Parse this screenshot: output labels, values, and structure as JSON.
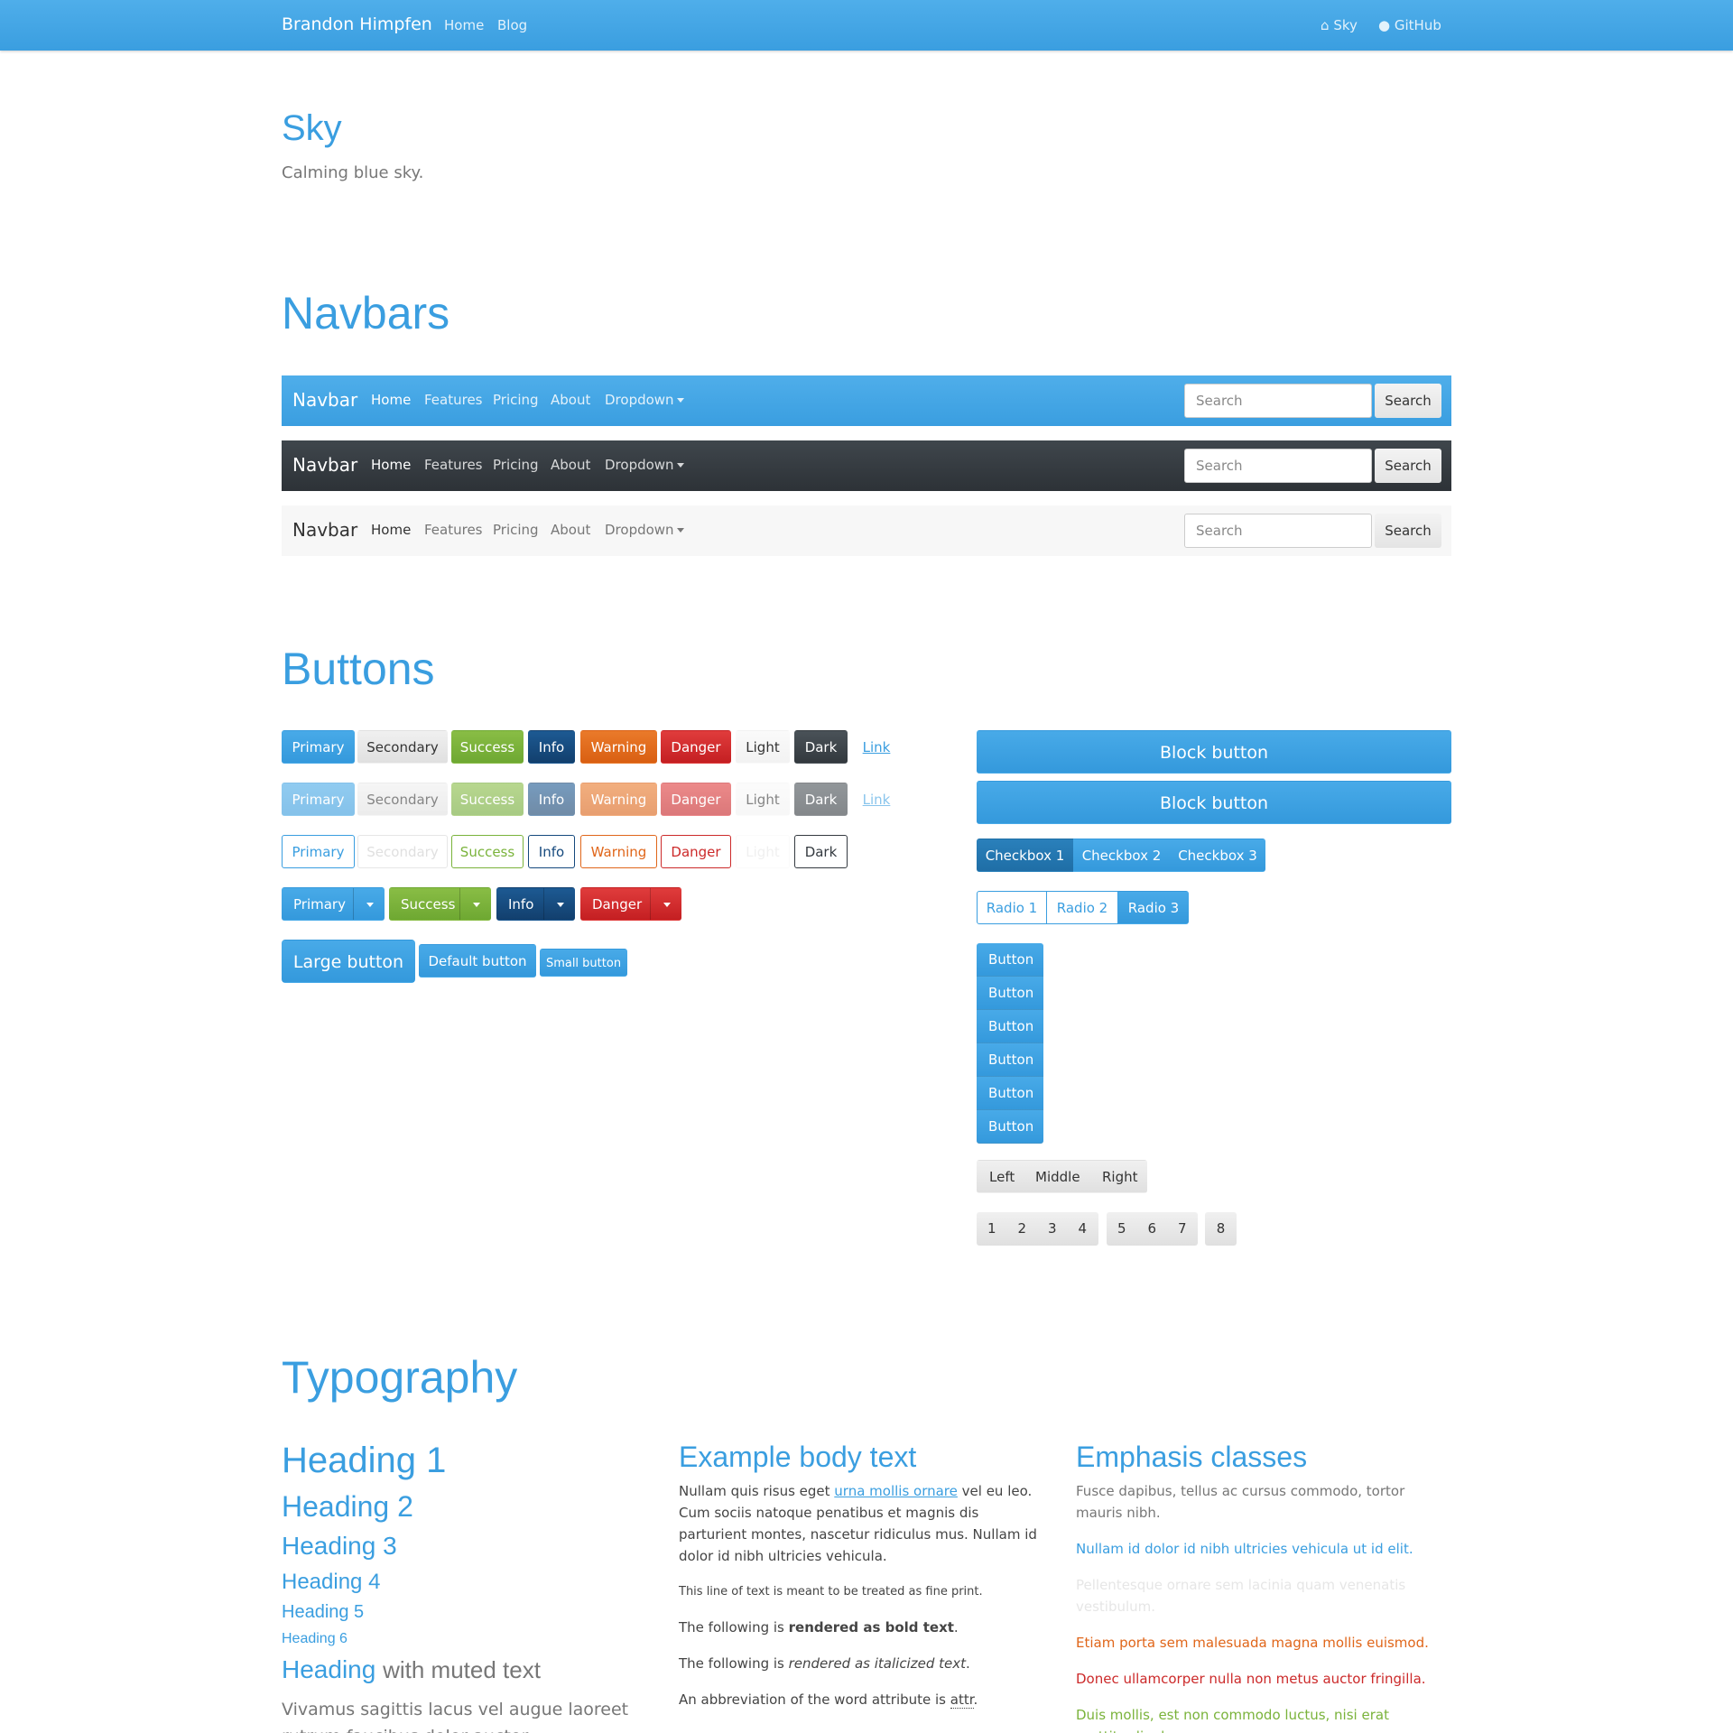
{
  "topbar": {
    "brand": "Brandon Himpfen",
    "links": [
      "Home",
      "Blog"
    ],
    "right": [
      "Sky",
      "GitHub"
    ]
  },
  "hero": {
    "title": "Sky",
    "subtitle": "Calming blue sky."
  },
  "navbars": {
    "heading": "Navbars",
    "brand": "Navbar",
    "links": [
      "Home",
      "Features",
      "Pricing",
      "About",
      "Dropdown"
    ],
    "search_placeholder": "Search",
    "search_button": "Search",
    "colors": {
      "primary": "#3a9ee0",
      "dark": "#343a40",
      "light": "#f7f7f7"
    }
  },
  "buttons": {
    "heading": "Buttons",
    "labels": [
      "Primary",
      "Secondary",
      "Success",
      "Info",
      "Warning",
      "Danger",
      "Light",
      "Dark",
      "Link"
    ],
    "split": [
      "Primary",
      "Success",
      "Info",
      "Danger"
    ],
    "sizes": [
      "Large button",
      "Default button",
      "Small button"
    ],
    "block": [
      "Block button",
      "Block button"
    ],
    "checkboxes": [
      "Checkbox 1",
      "Checkbox 2",
      "Checkbox 3"
    ],
    "radios": [
      "Radio 1",
      "Radio 2",
      "Radio 3"
    ],
    "vertical": [
      "Button",
      "Button",
      "Button",
      "Button",
      "Button",
      "Button"
    ],
    "group": [
      "Left",
      "Middle",
      "Right"
    ],
    "pages": [
      "1",
      "2",
      "3",
      "4",
      "5",
      "6",
      "7",
      "8"
    ]
  },
  "typography": {
    "heading": "Typography",
    "headings": [
      "Heading 1",
      "Heading 2",
      "Heading 3",
      "Heading 4",
      "Heading 5",
      "Heading 6"
    ],
    "muted_heading": "Heading",
    "muted_suffix": "with muted text",
    "lead": "Vivamus sagittis lacus vel augue laoreet rutrum faucibus dolor auctor.",
    "body_title": "Example body text",
    "body_p1_start": "Nullam quis risus eget ",
    "body_p1_link": "urna mollis ornare",
    "body_p1_end": " vel eu leo. Cum sociis natoque penatibus et magnis dis parturient montes, nascetur ridiculus mus. Nullam id dolor id nibh ultricies vehicula.",
    "fine_print": "This line of text is meant to be treated as fine print.",
    "bold_start": "The following is ",
    "bold_text": "rendered as bold text",
    "bold_end": ".",
    "italic_start": "The following is ",
    "italic_text": "rendered as italicized text",
    "italic_end": ".",
    "abbr_start": "An abbreviation of the word attribute is ",
    "abbr_text": "attr",
    "abbr_end": ".",
    "emphasis_title": "Emphasis classes",
    "emphasis": [
      {
        "text": "Fusce dapibus, tellus ac cursus commodo, tortor mauris nibh.",
        "color": "#777777"
      },
      {
        "text": "Nullam id dolor id nibh ultricies vehicula ut id elit.",
        "color": "#3a9ee0"
      },
      {
        "text": "Pellentesque ornare sem lacinia quam venenatis vestibulum.",
        "color": "#e6e6e6"
      },
      {
        "text": "Etiam porta sem malesuada magna mollis euismod.",
        "color": "#e0661a"
      },
      {
        "text": "Donec ullamcorper nulla non metus auctor fringilla.",
        "color": "#cc2a2a"
      },
      {
        "text": "Duis mollis, est non commodo luctus, nisi erat porttitor ligula.",
        "color": "#7ab33b"
      }
    ]
  }
}
